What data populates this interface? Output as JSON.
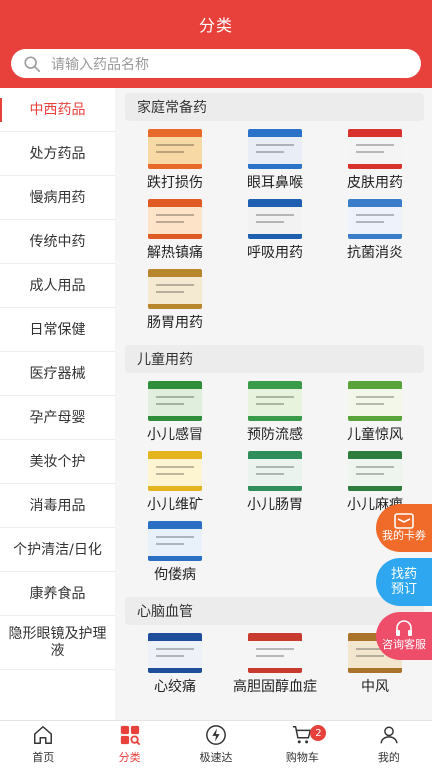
{
  "header": {
    "title": "分类"
  },
  "search": {
    "placeholder": "请输入药品名称"
  },
  "sidebar": {
    "items": [
      {
        "label": "中西药品"
      },
      {
        "label": "处方药品"
      },
      {
        "label": "慢病用药"
      },
      {
        "label": "传统中药"
      },
      {
        "label": "成人用品"
      },
      {
        "label": "日常保健"
      },
      {
        "label": "医疗器械"
      },
      {
        "label": "孕产母婴"
      },
      {
        "label": "美妆个护"
      },
      {
        "label": "消毒用品"
      },
      {
        "label": "个护清洁/日化"
      },
      {
        "label": "康养食品"
      },
      {
        "label": "隐形眼镜及护理液"
      }
    ]
  },
  "sections": [
    {
      "title": "家庭常备药",
      "items": [
        {
          "name": "跌打损伤",
          "colors": [
            "#e86a2b",
            "#f7d9a6"
          ]
        },
        {
          "name": "眼耳鼻喉",
          "colors": [
            "#2a73c9",
            "#e9eef6"
          ]
        },
        {
          "name": "皮肤用药",
          "colors": [
            "#d8322d",
            "#f4f4f4"
          ]
        },
        {
          "name": "解热镇痛",
          "colors": [
            "#e05a24",
            "#fde3c8"
          ]
        },
        {
          "name": "呼吸用药",
          "colors": [
            "#1f5fb0",
            "#f2f2f2"
          ]
        },
        {
          "name": "抗菌消炎",
          "colors": [
            "#3a7dc8",
            "#eef3fb"
          ]
        },
        {
          "name": "肠胃用药",
          "colors": [
            "#b8862d",
            "#f4ead2"
          ]
        }
      ]
    },
    {
      "title": "儿童用药",
      "items": [
        {
          "name": "小儿感冒",
          "colors": [
            "#2f8e3a",
            "#dfeedd"
          ]
        },
        {
          "name": "预防流感",
          "colors": [
            "#3a9b4a",
            "#e7f3dc"
          ]
        },
        {
          "name": "儿童惊风",
          "colors": [
            "#58a33a",
            "#f3f7ea"
          ]
        },
        {
          "name": "小儿维矿",
          "colors": [
            "#e3b41d",
            "#fdf4d2"
          ]
        },
        {
          "name": "小儿肠胃",
          "colors": [
            "#2f8e5a",
            "#eaf3ee"
          ]
        },
        {
          "name": "小儿麻痹",
          "colors": [
            "#2e7d3c",
            "#eef4ee"
          ]
        },
        {
          "name": "佝偻病",
          "colors": [
            "#2a6fc4",
            "#e8f0fa"
          ]
        }
      ]
    },
    {
      "title": "心脑血管",
      "items": [
        {
          "name": "心绞痛",
          "colors": [
            "#1e4e9b",
            "#eef1f7"
          ]
        },
        {
          "name": "高胆固醇血症",
          "colors": [
            "#c93a2e",
            "#f5f5f5"
          ]
        },
        {
          "name": "中风",
          "colors": [
            "#a9742a",
            "#f3e6cf"
          ]
        }
      ]
    }
  ],
  "floating": {
    "card": {
      "label": "我的卡券",
      "color": "#f06a2a"
    },
    "order": {
      "label": "找药预订",
      "color": "#2fa7f0"
    },
    "service": {
      "label": "咨询客服",
      "color": "#ee4e6a"
    }
  },
  "tabbar": {
    "items": [
      {
        "label": "首页",
        "icon": "home-icon"
      },
      {
        "label": "分类",
        "icon": "category-icon"
      },
      {
        "label": "极速达",
        "icon": "lightning-icon"
      },
      {
        "label": "购物车",
        "icon": "cart-icon",
        "badge": "2"
      },
      {
        "label": "我的",
        "icon": "user-icon"
      }
    ],
    "active_color": "#e8413c"
  },
  "colors": {
    "brand": "#e8413c"
  }
}
